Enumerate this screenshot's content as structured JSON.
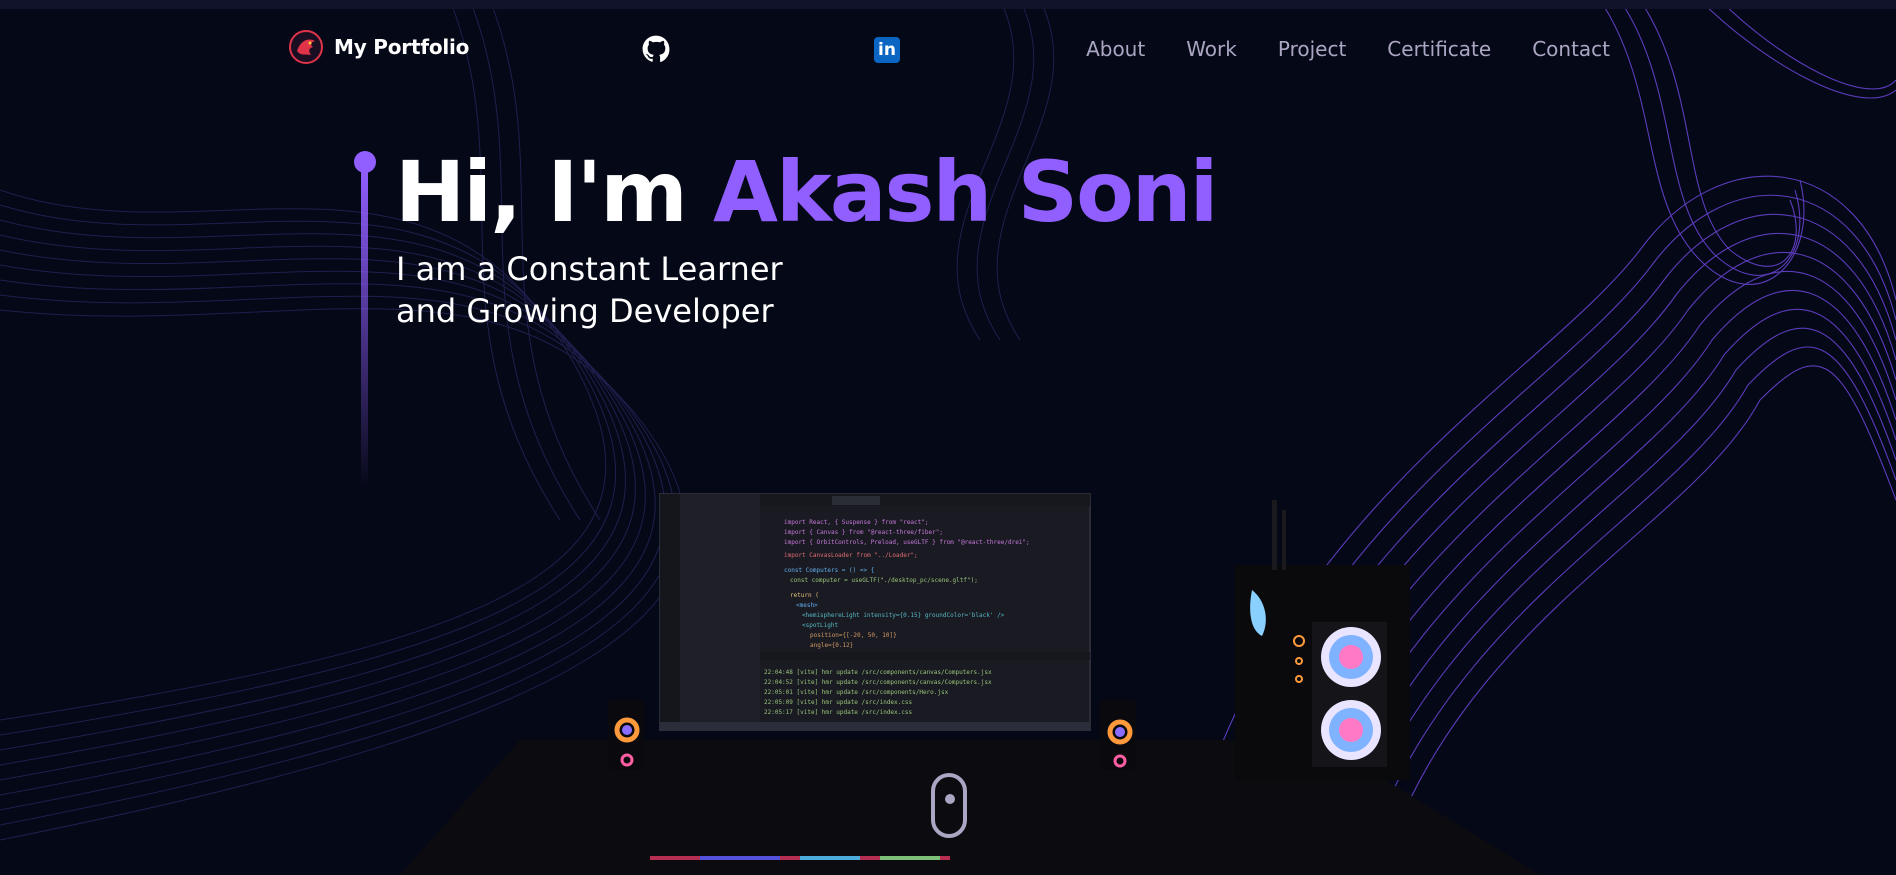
{
  "nav": {
    "logo_text": "My Portfolio",
    "links": [
      {
        "label": "About"
      },
      {
        "label": "Work"
      },
      {
        "label": "Project"
      },
      {
        "label": "Certificate"
      },
      {
        "label": "Contact"
      }
    ],
    "linkedin_label": "in"
  },
  "hero": {
    "greeting": "Hi, I'm ",
    "name": "Akash Soni",
    "subtitle_line1": "I am a Constant Learner",
    "subtitle_line2": "and Growing Developer"
  },
  "colors": {
    "background": "#050816",
    "accent": "#915eff",
    "nav_text": "#aaa6c3"
  },
  "icons": [
    "github-icon",
    "linkedin-icon",
    "logo-icon",
    "scroll-mouse-icon"
  ]
}
